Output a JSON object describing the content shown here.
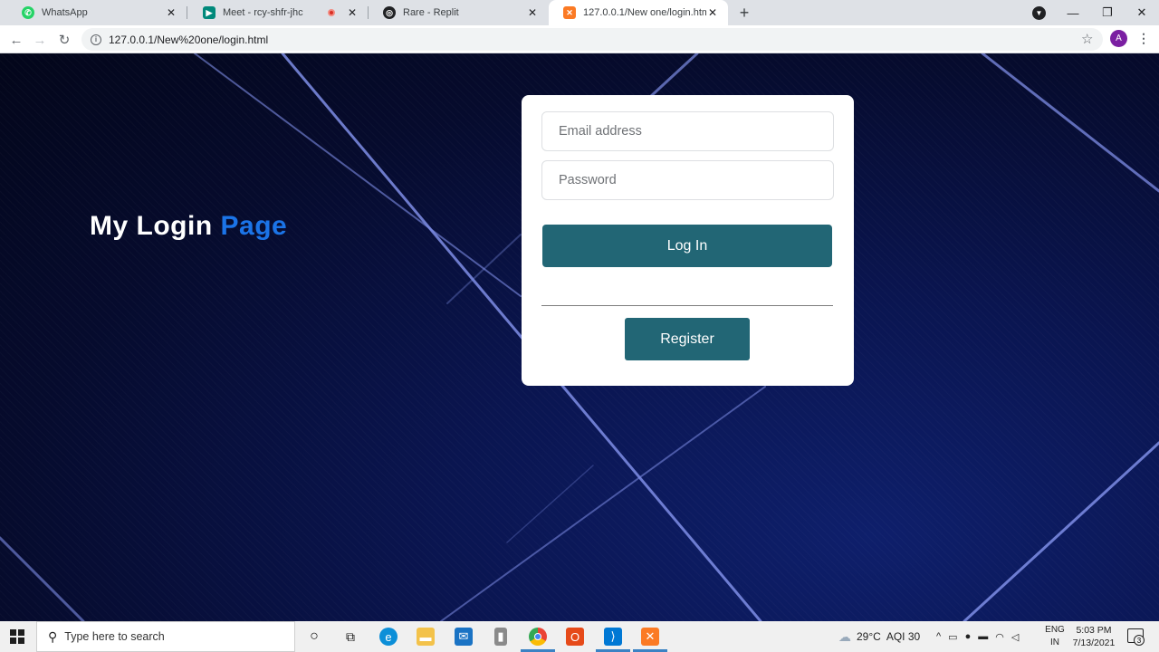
{
  "browser": {
    "tabs": [
      {
        "title": "WhatsApp",
        "favicon": "whatsapp-icon",
        "color": "#25d366"
      },
      {
        "title": "Meet - rcy-shfr-jhc",
        "favicon": "google-meet-icon",
        "color": "#00897b"
      },
      {
        "title": "Rare - Replit",
        "favicon": "replit-icon",
        "color": "#202124"
      },
      {
        "title": "127.0.0.1/New one/login.html",
        "favicon": "xampp-icon",
        "color": "#fb7a24"
      }
    ],
    "active_tab": 3,
    "url": "127.0.0.1/New%20one/login.html",
    "profile_initial": "A"
  },
  "page": {
    "heading_prefix": "My Login",
    "heading_accent": "Page",
    "email_placeholder": "Email address",
    "password_placeholder": "Password",
    "login_label": "Log In",
    "register_label": "Register",
    "accent_color": "#1b74e8",
    "button_color": "#226675"
  },
  "taskbar": {
    "search_placeholder": "Type here to search",
    "weather": "29°C",
    "aqi": "AQI 30",
    "lang_line1": "ENG",
    "lang_line2": "IN",
    "time": "5:03 PM",
    "date": "7/13/2021",
    "notification_count": "3",
    "pinned_apps": [
      "cortana-icon",
      "task-view-icon",
      "edge-icon",
      "file-explorer-icon",
      "mail-icon",
      "app-icon",
      "chrome-icon",
      "office-icon",
      "vscode-icon",
      "xampp-icon"
    ]
  }
}
